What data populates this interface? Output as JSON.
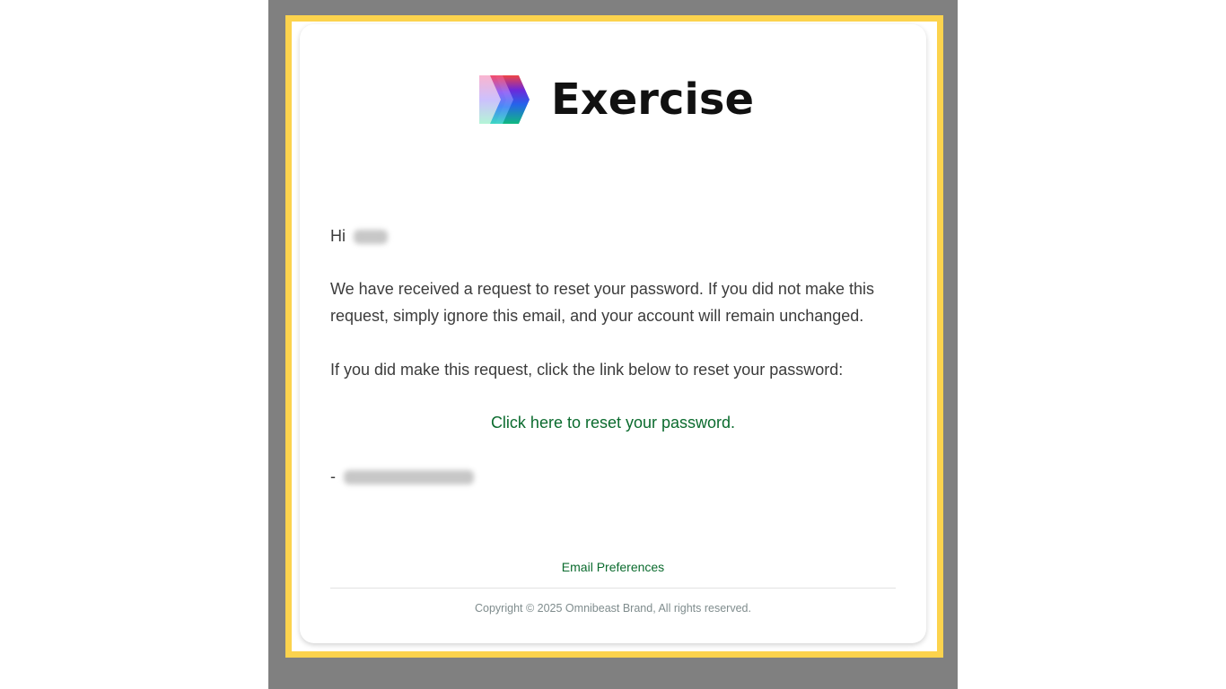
{
  "brand": {
    "name": "Exercise",
    "logo_icon": "chevron-stack-logo-icon"
  },
  "email": {
    "greeting": "Hi",
    "recipient_name_redacted": true,
    "paragraph_1": "We have received a request to reset your password. If you did not make this request, simply ignore this email, and your account will remain unchanged.",
    "paragraph_2": "If you did make this request, click the link below to reset your password:",
    "reset_link_label": "Click here to reset your password.",
    "signoff_prefix": "-",
    "signoff_brand_redacted": true
  },
  "footer": {
    "preferences_label": "Email Preferences",
    "copyright": "Copyright © 2025 Omnibeast Brand, All rights reserved."
  },
  "colors": {
    "link_green": "#0b6b2e",
    "frame_yellow": "#fcd34d",
    "backdrop_gray": "#808080"
  }
}
